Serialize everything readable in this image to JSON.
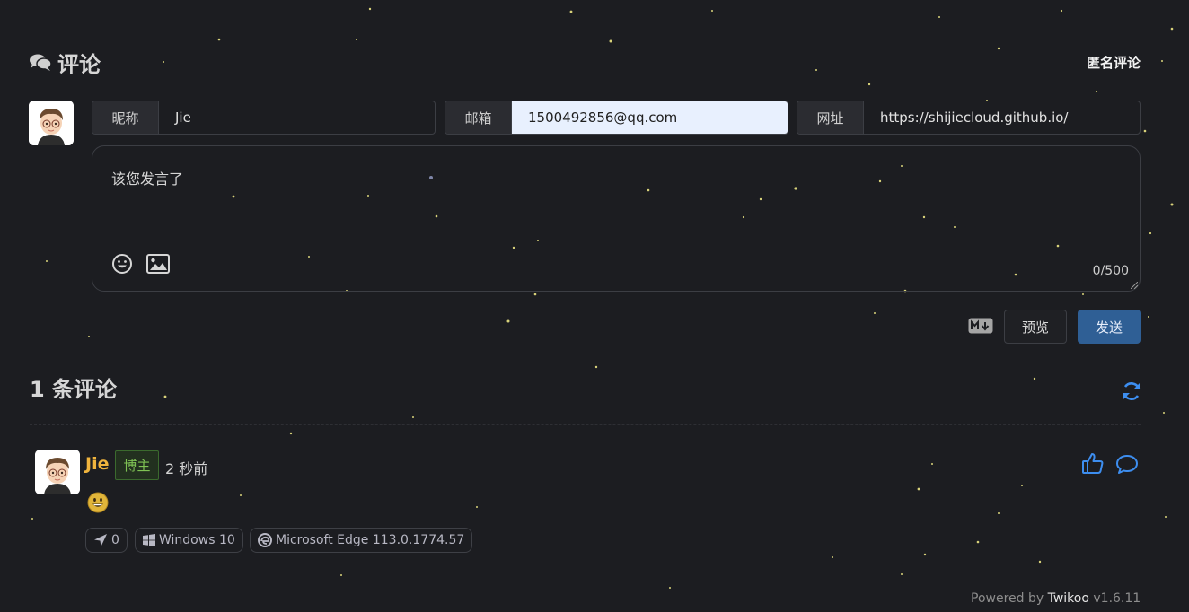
{
  "header": {
    "title": "评论",
    "title_icon": "comments-icon",
    "anonymous_label": "匿名评论"
  },
  "form": {
    "fields": [
      {
        "label": "昵称",
        "value": "Jie"
      },
      {
        "label": "邮箱",
        "value": "1500492856@qq.com"
      },
      {
        "label": "网址",
        "value": "https://shijiecloud.github.io/"
      }
    ],
    "textarea_placeholder": "该您发言了",
    "char_count": "0/500",
    "toolbar_icons": [
      "emoji-icon",
      "image-icon"
    ],
    "markdown_icon": "markdown-icon",
    "preview_label": "预览",
    "send_label": "发送"
  },
  "comments_header": {
    "count_title": "1 条评论",
    "refresh_icon": "refresh-icon"
  },
  "comments": [
    {
      "nick": "Jie",
      "badge": "博主",
      "time": "2 秒前",
      "content_emoji": "grinning-emoji",
      "tags": [
        {
          "icon": "location-arrow-icon",
          "text": "0"
        },
        {
          "icon": "windows-icon",
          "text": "Windows 10"
        },
        {
          "icon": "edge-icon",
          "text": "Microsoft Edge 113.0.1774.57"
        }
      ]
    }
  ],
  "footer": {
    "powered_prefix": "Powered by ",
    "brand": "Twikoo",
    "version": " v1.6.11"
  },
  "colors": {
    "background": "#1c1d21",
    "accent_blue": "#3d8ef0",
    "send_button": "#2f5f95",
    "nick": "#f0b43d",
    "badge_text": "#7fc254",
    "autofill_bg": "#e8f0fe"
  }
}
